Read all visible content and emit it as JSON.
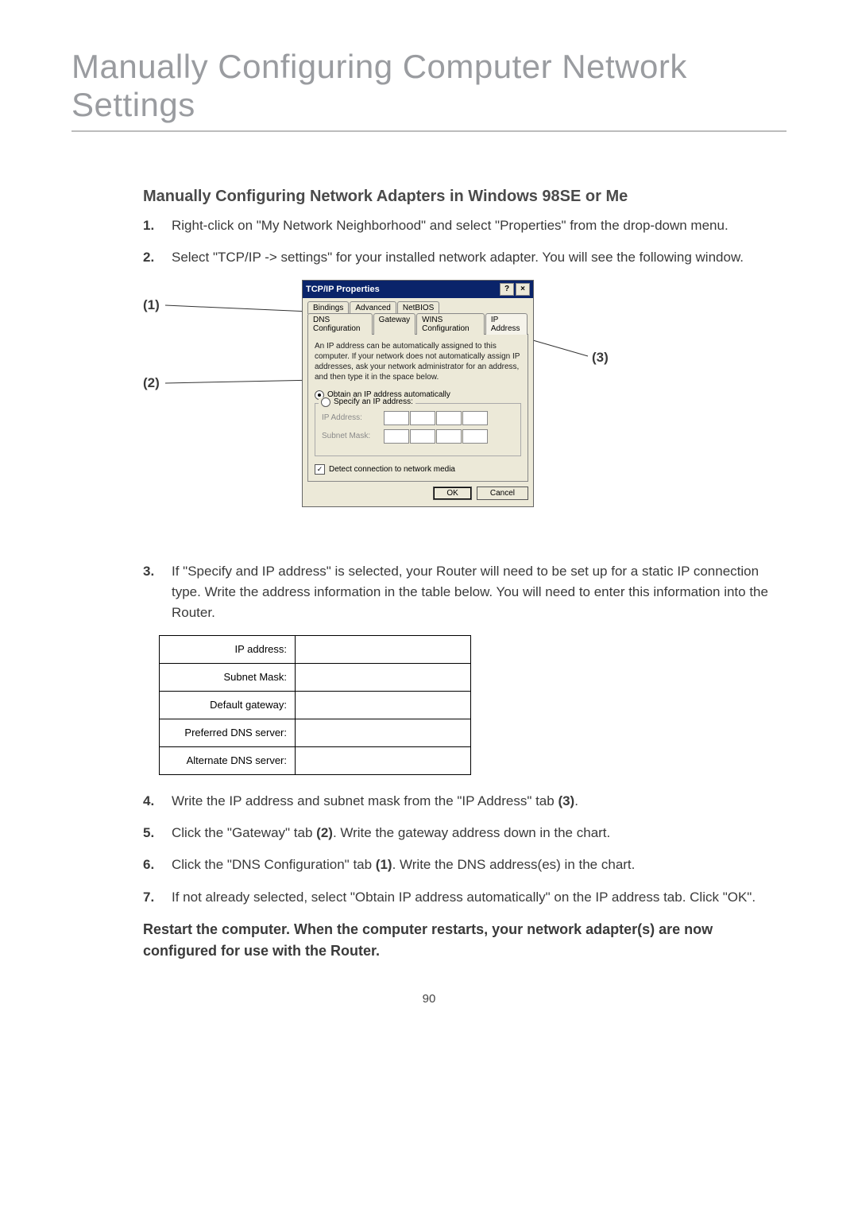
{
  "page_title": "Manually Configuring Computer Network Settings",
  "section_heading": "Manually Configuring Network Adapters in Windows 98SE or Me",
  "steps_a": [
    {
      "n": "1.",
      "t": "Right-click on \"My Network Neighborhood\" and select \"Properties\" from the drop-down menu."
    },
    {
      "n": "2.",
      "t": "Select \"TCP/IP -> settings\" for your installed network adapter. You will see the following window."
    }
  ],
  "callouts": {
    "c1": "(1)",
    "c2": "(2)",
    "c3": "(3)"
  },
  "dialog": {
    "title": "TCP/IP Properties",
    "help_btn": "?",
    "close_btn": "×",
    "tabs_row1": [
      "Bindings",
      "Advanced",
      "NetBIOS"
    ],
    "tabs_row2": [
      "DNS Configuration",
      "Gateway",
      "WINS Configuration",
      "IP Address"
    ],
    "active_tab": "IP Address",
    "info": "An IP address can be automatically assigned to this computer. If your network does not automatically assign IP addresses, ask your network administrator for an address, and then type it in the space below.",
    "radio_auto": "Obtain an IP address automatically",
    "radio_specify": "Specify an IP address:",
    "ip_label": "IP Address:",
    "mask_label": "Subnet Mask:",
    "detect": "Detect connection to network media",
    "ok": "OK",
    "cancel": "Cancel"
  },
  "step3": {
    "n": "3.",
    "t": "If \"Specify and IP address\" is selected, your Router will need to be set up for a static IP connection type. Write the address information in the table below. You will need to enter this information into the Router."
  },
  "table_rows": [
    "IP address:",
    "Subnet Mask:",
    "Default gateway:",
    "Preferred DNS server:",
    "Alternate DNS server:"
  ],
  "steps_b": [
    {
      "n": "4.",
      "pre": "Write the IP address and subnet mask from the \"IP Address\" tab ",
      "bold": "(3)",
      "post": "."
    },
    {
      "n": "5.",
      "pre": "Click the \"Gateway\" tab ",
      "bold": "(2)",
      "post": ". Write the gateway address down in the chart."
    },
    {
      "n": "6.",
      "pre": "Click the \"DNS Configuration\" tab ",
      "bold": "(1)",
      "post": ". Write the DNS address(es) in the chart."
    },
    {
      "n": "7.",
      "pre": "If not already selected, select \"Obtain IP address automatically\" on the IP address tab. Click \"OK\".",
      "bold": "",
      "post": ""
    }
  ],
  "restart": "Restart the computer. When the computer restarts, your network adapter(s) are now configured for use with the Router.",
  "page_number": "90"
}
